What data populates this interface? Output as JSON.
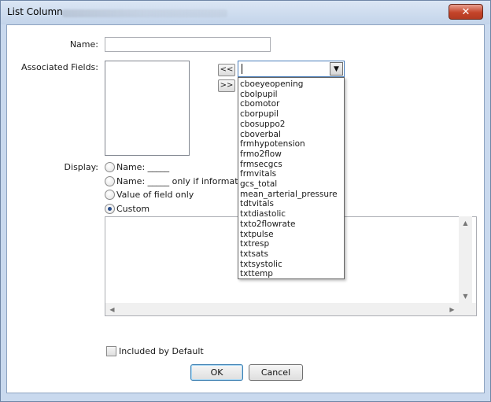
{
  "window": {
    "title": "List Column",
    "close_label": "✕",
    "title_bar_color": "#c3d4ea",
    "close_color": "#c4442a"
  },
  "form": {
    "name_label": "Name:",
    "name_value": "",
    "associated_label": "Associated Fields:",
    "add_label": "<<",
    "remove_label": ">>",
    "combo_value": "",
    "display_label": "Display:"
  },
  "dropdown": {
    "options": [
      "cboeyeopening",
      "cbolpupil",
      "cbomotor",
      "cborpupil",
      "cbosuppo2",
      "cboverbal",
      "frmhypotension",
      "frmo2flow",
      "frmsecgcs",
      "frmvitals",
      "gcs_total",
      "mean_arterial_pressure",
      "tdtvitals",
      "txtdiastolic",
      "txto2flowrate",
      "txtpulse",
      "txtresp",
      "txtsats",
      "txtsystolic",
      "txttemp"
    ]
  },
  "display": {
    "options": [
      {
        "label": "Name: _____",
        "checked": false
      },
      {
        "label": "Name: _____ only if information i",
        "checked": false
      },
      {
        "label": "Value of field only",
        "checked": false
      },
      {
        "label": "Custom",
        "checked": true
      }
    ],
    "custom_text": ""
  },
  "included": {
    "label": "Included by Default",
    "checked": false
  },
  "buttons": {
    "ok": "OK",
    "cancel": "Cancel"
  },
  "icons": {
    "dropdown_arrow": "▼",
    "scroll_up": "▲",
    "scroll_down": "▼",
    "scroll_left": "◀",
    "scroll_right": "▶"
  }
}
